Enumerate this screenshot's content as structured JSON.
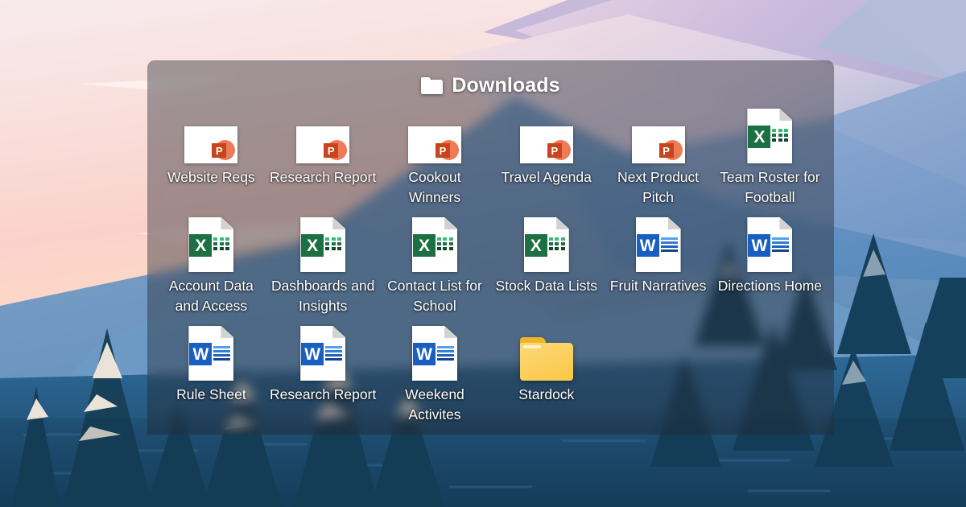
{
  "window": {
    "title": "Downloads",
    "folder_icon": "folder-icon"
  },
  "colors": {
    "panel_overlay": "#242630",
    "excel_green": "#1d7044",
    "word_blue": "#1a5fc0",
    "powerpoint_orange": "#c8441d",
    "folder_yellow": "#fbcf5c",
    "label_text": "#ffffff"
  },
  "items": [
    {
      "label": "Website Reqs",
      "type": "powerpoint",
      "icon": "powerpoint-file-icon",
      "glyph": "P"
    },
    {
      "label": "Research Report",
      "type": "powerpoint",
      "icon": "powerpoint-file-icon",
      "glyph": "P"
    },
    {
      "label": "Cookout Winners",
      "type": "powerpoint",
      "icon": "powerpoint-file-icon",
      "glyph": "P"
    },
    {
      "label": "Travel Agenda",
      "type": "powerpoint",
      "icon": "powerpoint-file-icon",
      "glyph": "P"
    },
    {
      "label": "Next Product Pitch",
      "type": "powerpoint",
      "icon": "powerpoint-file-icon",
      "glyph": "P"
    },
    {
      "label": "Team Roster for Football",
      "type": "excel",
      "icon": "excel-file-icon",
      "glyph": "X"
    },
    {
      "label": "Account Data and Access",
      "type": "excel",
      "icon": "excel-file-icon",
      "glyph": "X"
    },
    {
      "label": "Dashboards and Insights",
      "type": "excel",
      "icon": "excel-file-icon",
      "glyph": "X"
    },
    {
      "label": "Contact List for School",
      "type": "excel",
      "icon": "excel-file-icon",
      "glyph": "X"
    },
    {
      "label": "Stock Data Lists",
      "type": "excel",
      "icon": "excel-file-icon",
      "glyph": "X"
    },
    {
      "label": "Fruit Narratives",
      "type": "word",
      "icon": "word-file-icon",
      "glyph": "W"
    },
    {
      "label": "Directions Home",
      "type": "word",
      "icon": "word-file-icon",
      "glyph": "W"
    },
    {
      "label": "Rule Sheet",
      "type": "word",
      "icon": "word-file-icon",
      "glyph": "W"
    },
    {
      "label": "Research Report",
      "type": "word",
      "icon": "word-file-icon",
      "glyph": "W"
    },
    {
      "label": "Weekend Activites",
      "type": "word",
      "icon": "word-file-icon",
      "glyph": "W"
    },
    {
      "label": "Stardock",
      "type": "folder",
      "icon": "folder-icon",
      "glyph": ""
    }
  ]
}
